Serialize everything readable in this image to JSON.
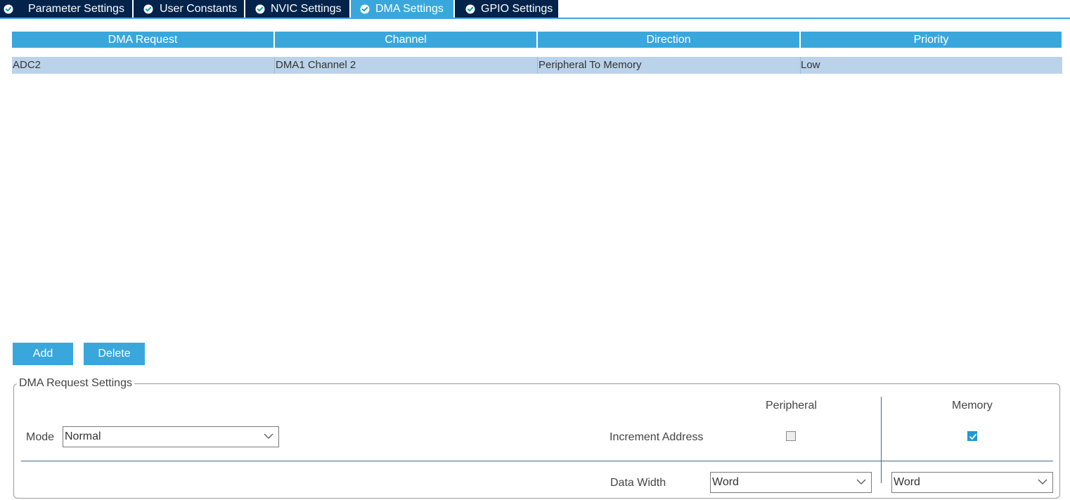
{
  "tabs": [
    {
      "label": "Parameter Settings",
      "active": false
    },
    {
      "label": "User Constants",
      "active": false
    },
    {
      "label": "NVIC Settings",
      "active": false
    },
    {
      "label": "DMA Settings",
      "active": true
    },
    {
      "label": "GPIO Settings",
      "active": false
    }
  ],
  "table": {
    "columns": [
      "DMA Request",
      "Channel",
      "Direction",
      "Priority"
    ],
    "rows": [
      [
        "ADC2",
        "DMA1 Channel 2",
        "Peripheral To Memory",
        "Low"
      ]
    ]
  },
  "actions": {
    "add_label": "Add",
    "delete_label": "Delete"
  },
  "settings": {
    "title": "DMA Request Settings",
    "mode_label": "Mode",
    "mode_value": "Normal",
    "peripheral_header": "Peripheral",
    "memory_header": "Memory",
    "increment_label": "Increment Address",
    "peripheral_increment": false,
    "memory_increment": true,
    "data_width_label": "Data Width",
    "peripheral_data_width": "Word",
    "memory_data_width": "Word"
  },
  "colors": {
    "tab_bg": "#03234b",
    "tab_active_bg": "#3aa7dc",
    "header_bg": "#3aa7dc",
    "selected_row_bg": "#bbd3ea",
    "check_icon_color": "#1f9ad6"
  },
  "icons": {
    "tab_icon": "check-circle-icon",
    "dropdown_icon": "chevron-down-icon",
    "checked_icon": "checkmark-icon"
  }
}
